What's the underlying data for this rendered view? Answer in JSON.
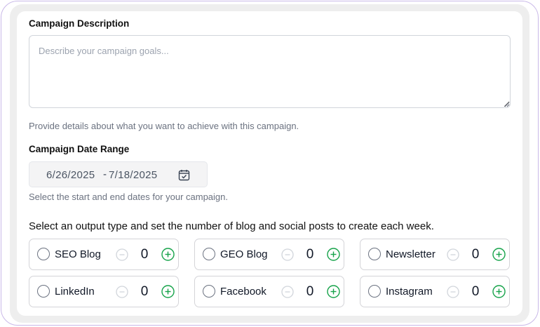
{
  "description": {
    "label": "Campaign Description",
    "placeholder": "Describe your campaign goals...",
    "value": "",
    "help": "Provide details about what you want to achieve with this campaign."
  },
  "date_range": {
    "label": "Campaign Date Range",
    "start": "6/26/2025",
    "separator": "-",
    "end": "7/18/2025",
    "help": "Select the start and end dates for your campaign."
  },
  "outputs": {
    "heading": "Select an output type and set the number of blog and social posts to create each week.",
    "items": [
      {
        "name": "SEO Blog",
        "count": "0",
        "selected": false
      },
      {
        "name": "GEO Blog",
        "count": "0",
        "selected": false
      },
      {
        "name": "Newsletter",
        "count": "0",
        "selected": false
      },
      {
        "name": "LinkedIn",
        "count": "0",
        "selected": false
      },
      {
        "name": "Facebook",
        "count": "0",
        "selected": false
      },
      {
        "name": "Instagram",
        "count": "0",
        "selected": false
      }
    ]
  },
  "colors": {
    "frame_border": "#c9b8e8",
    "plus_accent": "#16a34a",
    "minus_disabled": "#d1d5db"
  },
  "icons": {
    "date": "calendar-icon",
    "decrement": "minus-circle-icon",
    "increment": "plus-circle-icon"
  }
}
